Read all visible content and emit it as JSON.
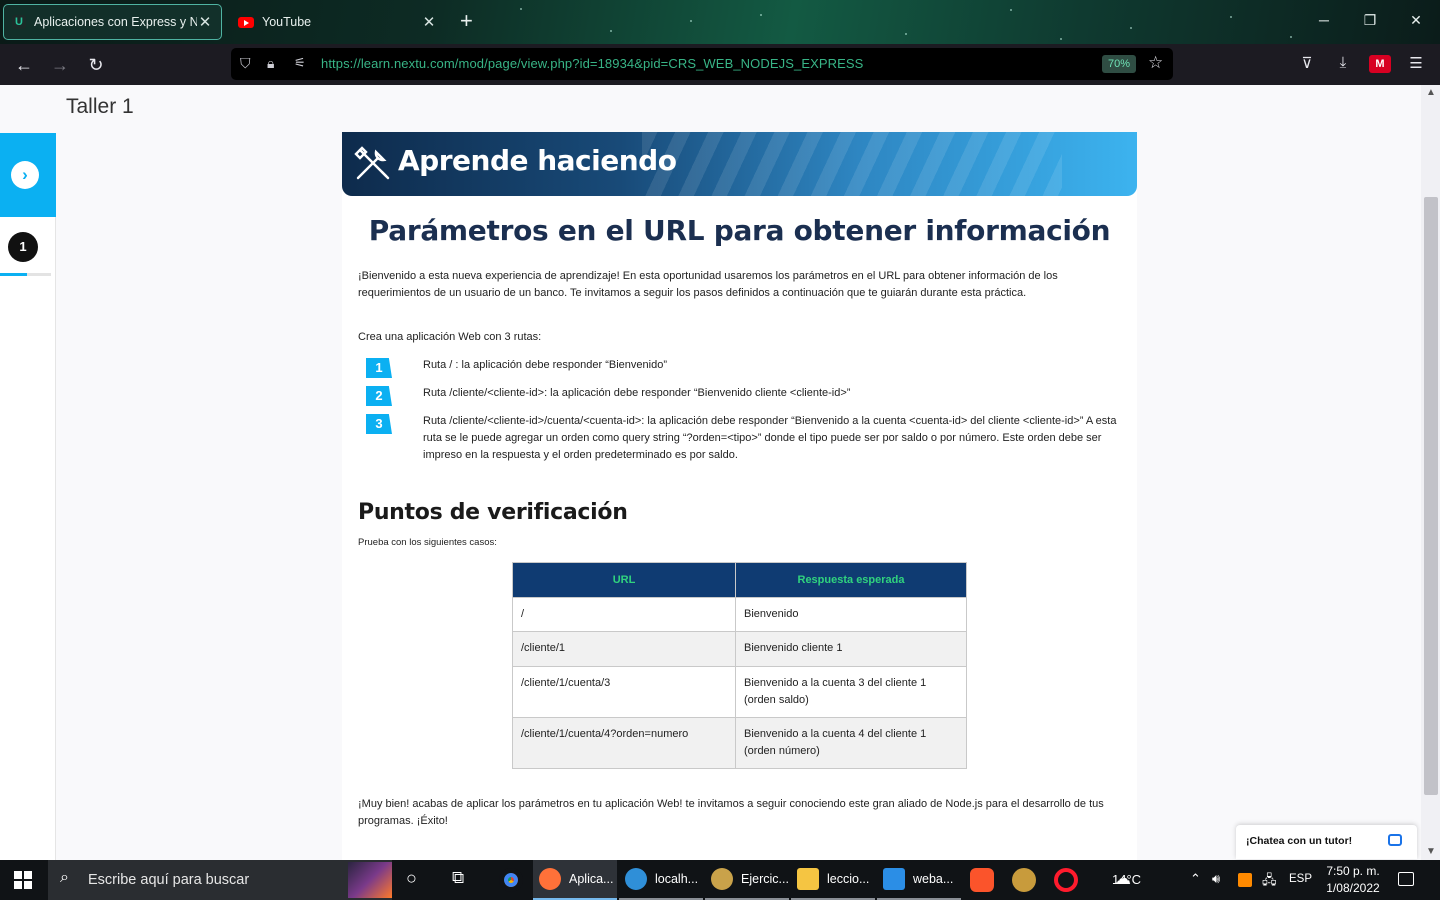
{
  "browser": {
    "tabs": [
      {
        "title": "Aplicaciones con Express y Nod",
        "active": true
      },
      {
        "title": "YouTube",
        "active": false
      }
    ],
    "url": "https://learn.nextu.com/mod/page/view.php?id=18934&pid=CRS_WEB_NODEJS_EXPRESS",
    "zoom": "70%"
  },
  "page": {
    "title": "Taller 1",
    "step": "1",
    "banner_title": "Aprende haciendo",
    "lesson_title": "Parámetros en el URL para obtener información",
    "intro": "¡Bienvenido a esta nueva experiencia de aprendizaje! En esta oportunidad usaremos los parámetros en el URL para obtener información de los requerimientos de un usuario de un banco. Te invitamos a seguir los pasos definidos a continuación que te guiarán durante esta práctica.",
    "routes_intro": "Crea una aplicación Web con 3 rutas:",
    "routes": [
      {
        "num": "1",
        "text": "Ruta / : la aplicación debe responder “Bienvenido”"
      },
      {
        "num": "2",
        "text": "Ruta /cliente/<cliente-id>: la aplicación debe responder “Bienvenido cliente <cliente-id>”"
      },
      {
        "num": "3",
        "text": "Ruta /cliente/<cliente-id>/cuenta/<cuenta-id>: la aplicación debe responder “Bienvenido a la cuenta <cuenta-id> del cliente <cliente-id>” A esta ruta se le puede agregar un orden como query string “?orden=<tipo>” donde el tipo puede ser por saldo o por número. Este orden debe ser impreso en la respuesta y el orden predeterminado es por saldo."
      }
    ],
    "verif_title": "Puntos de verificación",
    "verif_sub": "Prueba con los siguientes casos:",
    "table": {
      "headers": [
        "URL",
        "Respuesta esperada"
      ],
      "rows": [
        [
          "/",
          "Bienvenido"
        ],
        [
          "/cliente/1",
          "Bienvenido cliente 1"
        ],
        [
          "/cliente/1/cuenta/3",
          "Bienvenido a la cuenta 3 del cliente 1 (orden saldo)"
        ],
        [
          "/cliente/1/cuenta/4?orden=numero",
          "Bienvenido a la cuenta 4 del cliente 1 (orden número)"
        ]
      ]
    },
    "closing": "¡Muy bien! acabas de aplicar los parámetros en tu aplicación Web! te invitamos a seguir conociendo este gran aliado de Node.js para el desarrollo de tus programas. ¡Éxito!",
    "chat_label": "¡Chatea con un tutor!",
    "progress_fraction": 0.53
  },
  "taskbar": {
    "search_placeholder": "Escribe aquí para buscar",
    "apps": [
      {
        "label": "Aplica...",
        "color": "#ff7139"
      },
      {
        "label": "localh...",
        "color": "#2f8fd8"
      },
      {
        "label": "Ejercic...",
        "color": "#c9a24a"
      },
      {
        "label": "leccio...",
        "color": "#f5c542"
      },
      {
        "label": "weba...",
        "color": "#2b8ee6"
      }
    ],
    "temperature": "14°C",
    "language": "ESP",
    "time": "7:50 p. m.",
    "date": "1/08/2022"
  },
  "colors": {
    "accent": "#0bb0f2",
    "title_navy": "#1b2f50",
    "table_header": "#0f3b72",
    "table_header_text": "#30d37e",
    "url_green": "#38b486"
  }
}
